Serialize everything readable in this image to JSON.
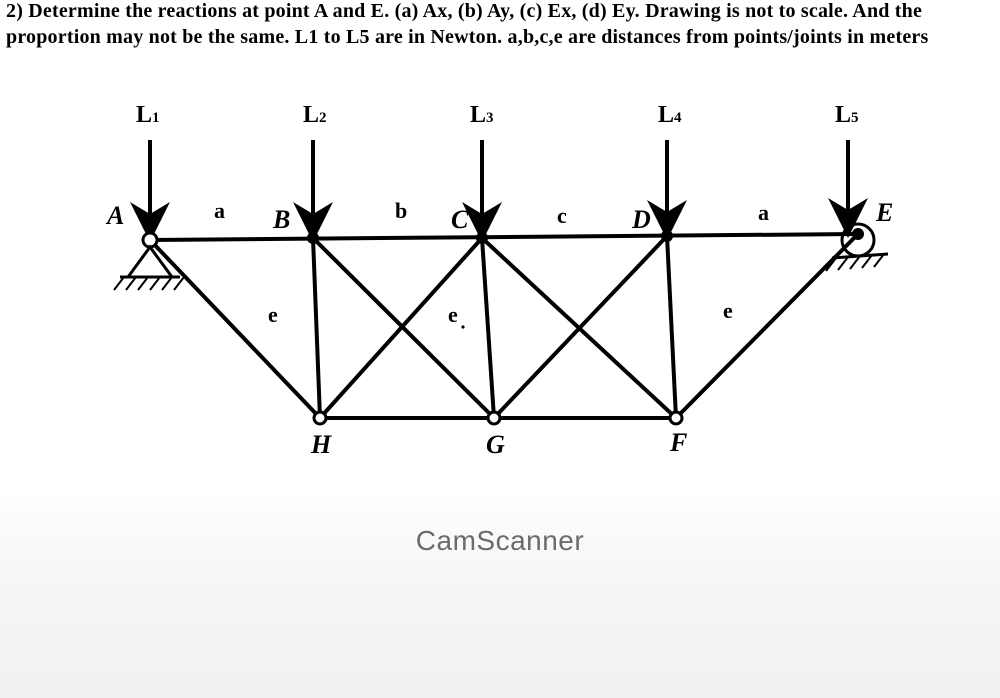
{
  "problem": "2) Determine the reactions at point A and E. (a) Ax, (b) Ay, (c) Ex, (d) Ey. Drawing is not to scale. And the proportion may not be the same. L1 to L5 are in Newton. a,b,c,e are distances from points/joints in meters",
  "loads": {
    "L1": "L",
    "L1s": "1",
    "L2": "L",
    "L2s": "2",
    "L3": "L",
    "L3s": "3",
    "L4": "L",
    "L4s": "4",
    "L5": "L",
    "L5s": "5"
  },
  "joints": {
    "A": "A",
    "B": "B",
    "C": "C",
    "D": "D",
    "E": "E",
    "H": "H",
    "G": "G",
    "F": "F"
  },
  "dists": {
    "AB": "a",
    "BC": "b",
    "CD": "c",
    "DE": "a",
    "e1": "e",
    "e2": "e",
    "e3": "e"
  },
  "watermark": "CamScanner"
}
